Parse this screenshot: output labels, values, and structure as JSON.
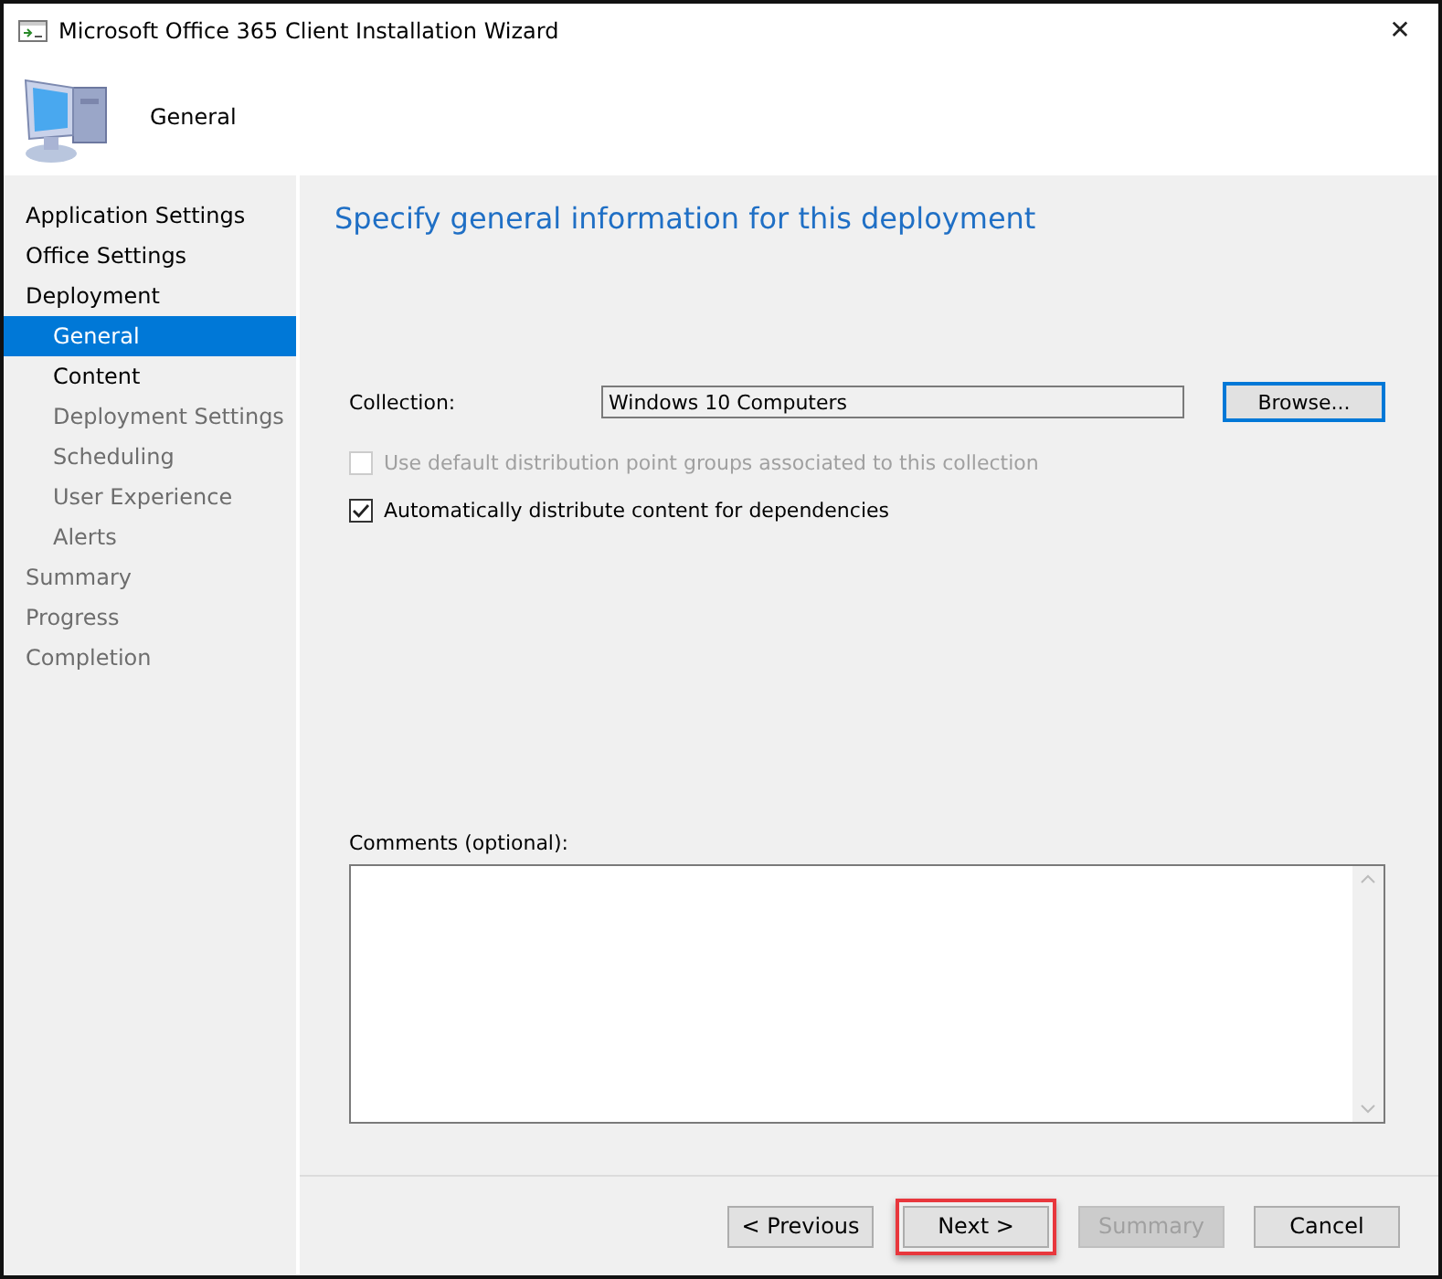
{
  "window": {
    "title": "Microsoft Office 365 Client Installation Wizard",
    "close": "✕"
  },
  "header": {
    "title": "General"
  },
  "sidebar": {
    "items": [
      {
        "label": "Application Settings",
        "selected": false,
        "disabled": false
      },
      {
        "label": "Office Settings",
        "selected": false,
        "disabled": false
      },
      {
        "label": "Deployment",
        "selected": false,
        "disabled": false,
        "children": [
          {
            "label": "General",
            "selected": true,
            "disabled": false
          },
          {
            "label": "Content",
            "selected": false,
            "disabled": false
          },
          {
            "label": "Deployment Settings",
            "selected": false,
            "disabled": true
          },
          {
            "label": "Scheduling",
            "selected": false,
            "disabled": true
          },
          {
            "label": "User Experience",
            "selected": false,
            "disabled": true
          },
          {
            "label": "Alerts",
            "selected": false,
            "disabled": true
          }
        ]
      },
      {
        "label": "Summary",
        "selected": false,
        "disabled": true
      },
      {
        "label": "Progress",
        "selected": false,
        "disabled": true
      },
      {
        "label": "Completion",
        "selected": false,
        "disabled": true
      }
    ]
  },
  "page": {
    "heading": "Specify general information for this deployment",
    "collection": {
      "label": "Collection:",
      "value": "Windows 10 Computers",
      "button": "Browse..."
    },
    "options": [
      {
        "label": "Use default distribution point groups associated to this collection",
        "checked": false,
        "disabled": true
      },
      {
        "label": "Automatically distribute content for dependencies",
        "checked": true,
        "disabled": false
      }
    ],
    "comments": {
      "label": "Comments (optional):"
    }
  },
  "buttons": [
    {
      "label": "< Previous",
      "disabled": false,
      "highlighted": false
    },
    {
      "label": "Next >",
      "disabled": false,
      "highlighted": true
    },
    {
      "label": "Summary",
      "disabled": true,
      "highlighted": false
    },
    {
      "label": "Cancel",
      "disabled": false,
      "highlighted": false
    }
  ]
}
